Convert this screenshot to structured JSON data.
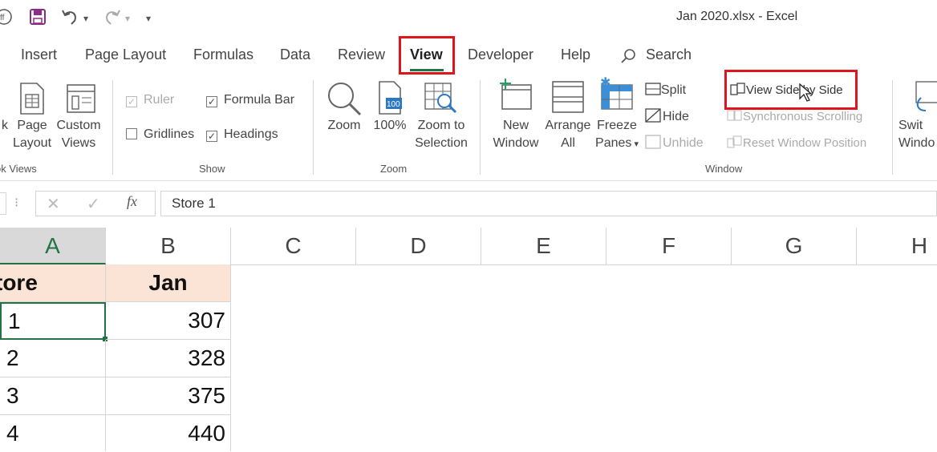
{
  "window": {
    "title": "Jan 2020.xlsx  -  Excel"
  },
  "tabs": [
    "Insert",
    "Page Layout",
    "Formulas",
    "Data",
    "Review",
    "View",
    "Developer",
    "Help",
    "Search"
  ],
  "ribbon": {
    "workbook_views": {
      "items": [
        {
          "label_lines": [
            "k",
            ""
          ],
          "icon": "book-icon"
        },
        {
          "label_lines": [
            "Page",
            "Layout"
          ],
          "icon": "page-layout-icon"
        },
        {
          "label_lines": [
            "Custom",
            "Views"
          ],
          "icon": "custom-views-icon"
        }
      ],
      "group_label": "ok Views"
    },
    "show": {
      "ruler": "Ruler",
      "formula_bar": "Formula Bar",
      "gridlines": "Gridlines",
      "headings": "Headings",
      "group_label": "Show"
    },
    "zoom": {
      "zoom": "Zoom",
      "hundred": "100%",
      "zoom_sel_1": "Zoom to",
      "zoom_sel_2": "Selection",
      "badge": "100",
      "group_label": "Zoom"
    },
    "window": {
      "new_1": "New",
      "new_2": "Window",
      "arrange_1": "Arrange",
      "arrange_2": "All",
      "freeze_1": "Freeze",
      "freeze_2": "Panes",
      "split": "Split",
      "hide": "Hide",
      "unhide": "Unhide",
      "view_side_by_side": "View Side by Side",
      "sync_scroll": "Synchronous Scrolling",
      "reset_pos": "Reset Window Position",
      "switch_1": "Swit",
      "switch_2": "Windo",
      "group_label": "Window"
    }
  },
  "formula_bar": {
    "value": "Store 1",
    "fx": "fx"
  },
  "columns": [
    "A",
    "B",
    "C",
    "D",
    "E",
    "F",
    "G",
    "H"
  ],
  "rows": [
    {
      "a": "tore",
      "b": "Jan"
    },
    {
      "a": "1",
      "b": "307"
    },
    {
      "a": "2",
      "b": "328"
    },
    {
      "a": "3",
      "b": "375"
    },
    {
      "a": "4",
      "b": "440"
    }
  ],
  "colors": {
    "header_fill": "#fbe4d5",
    "highlight": "#e0141c",
    "excel_green": "#217346"
  }
}
